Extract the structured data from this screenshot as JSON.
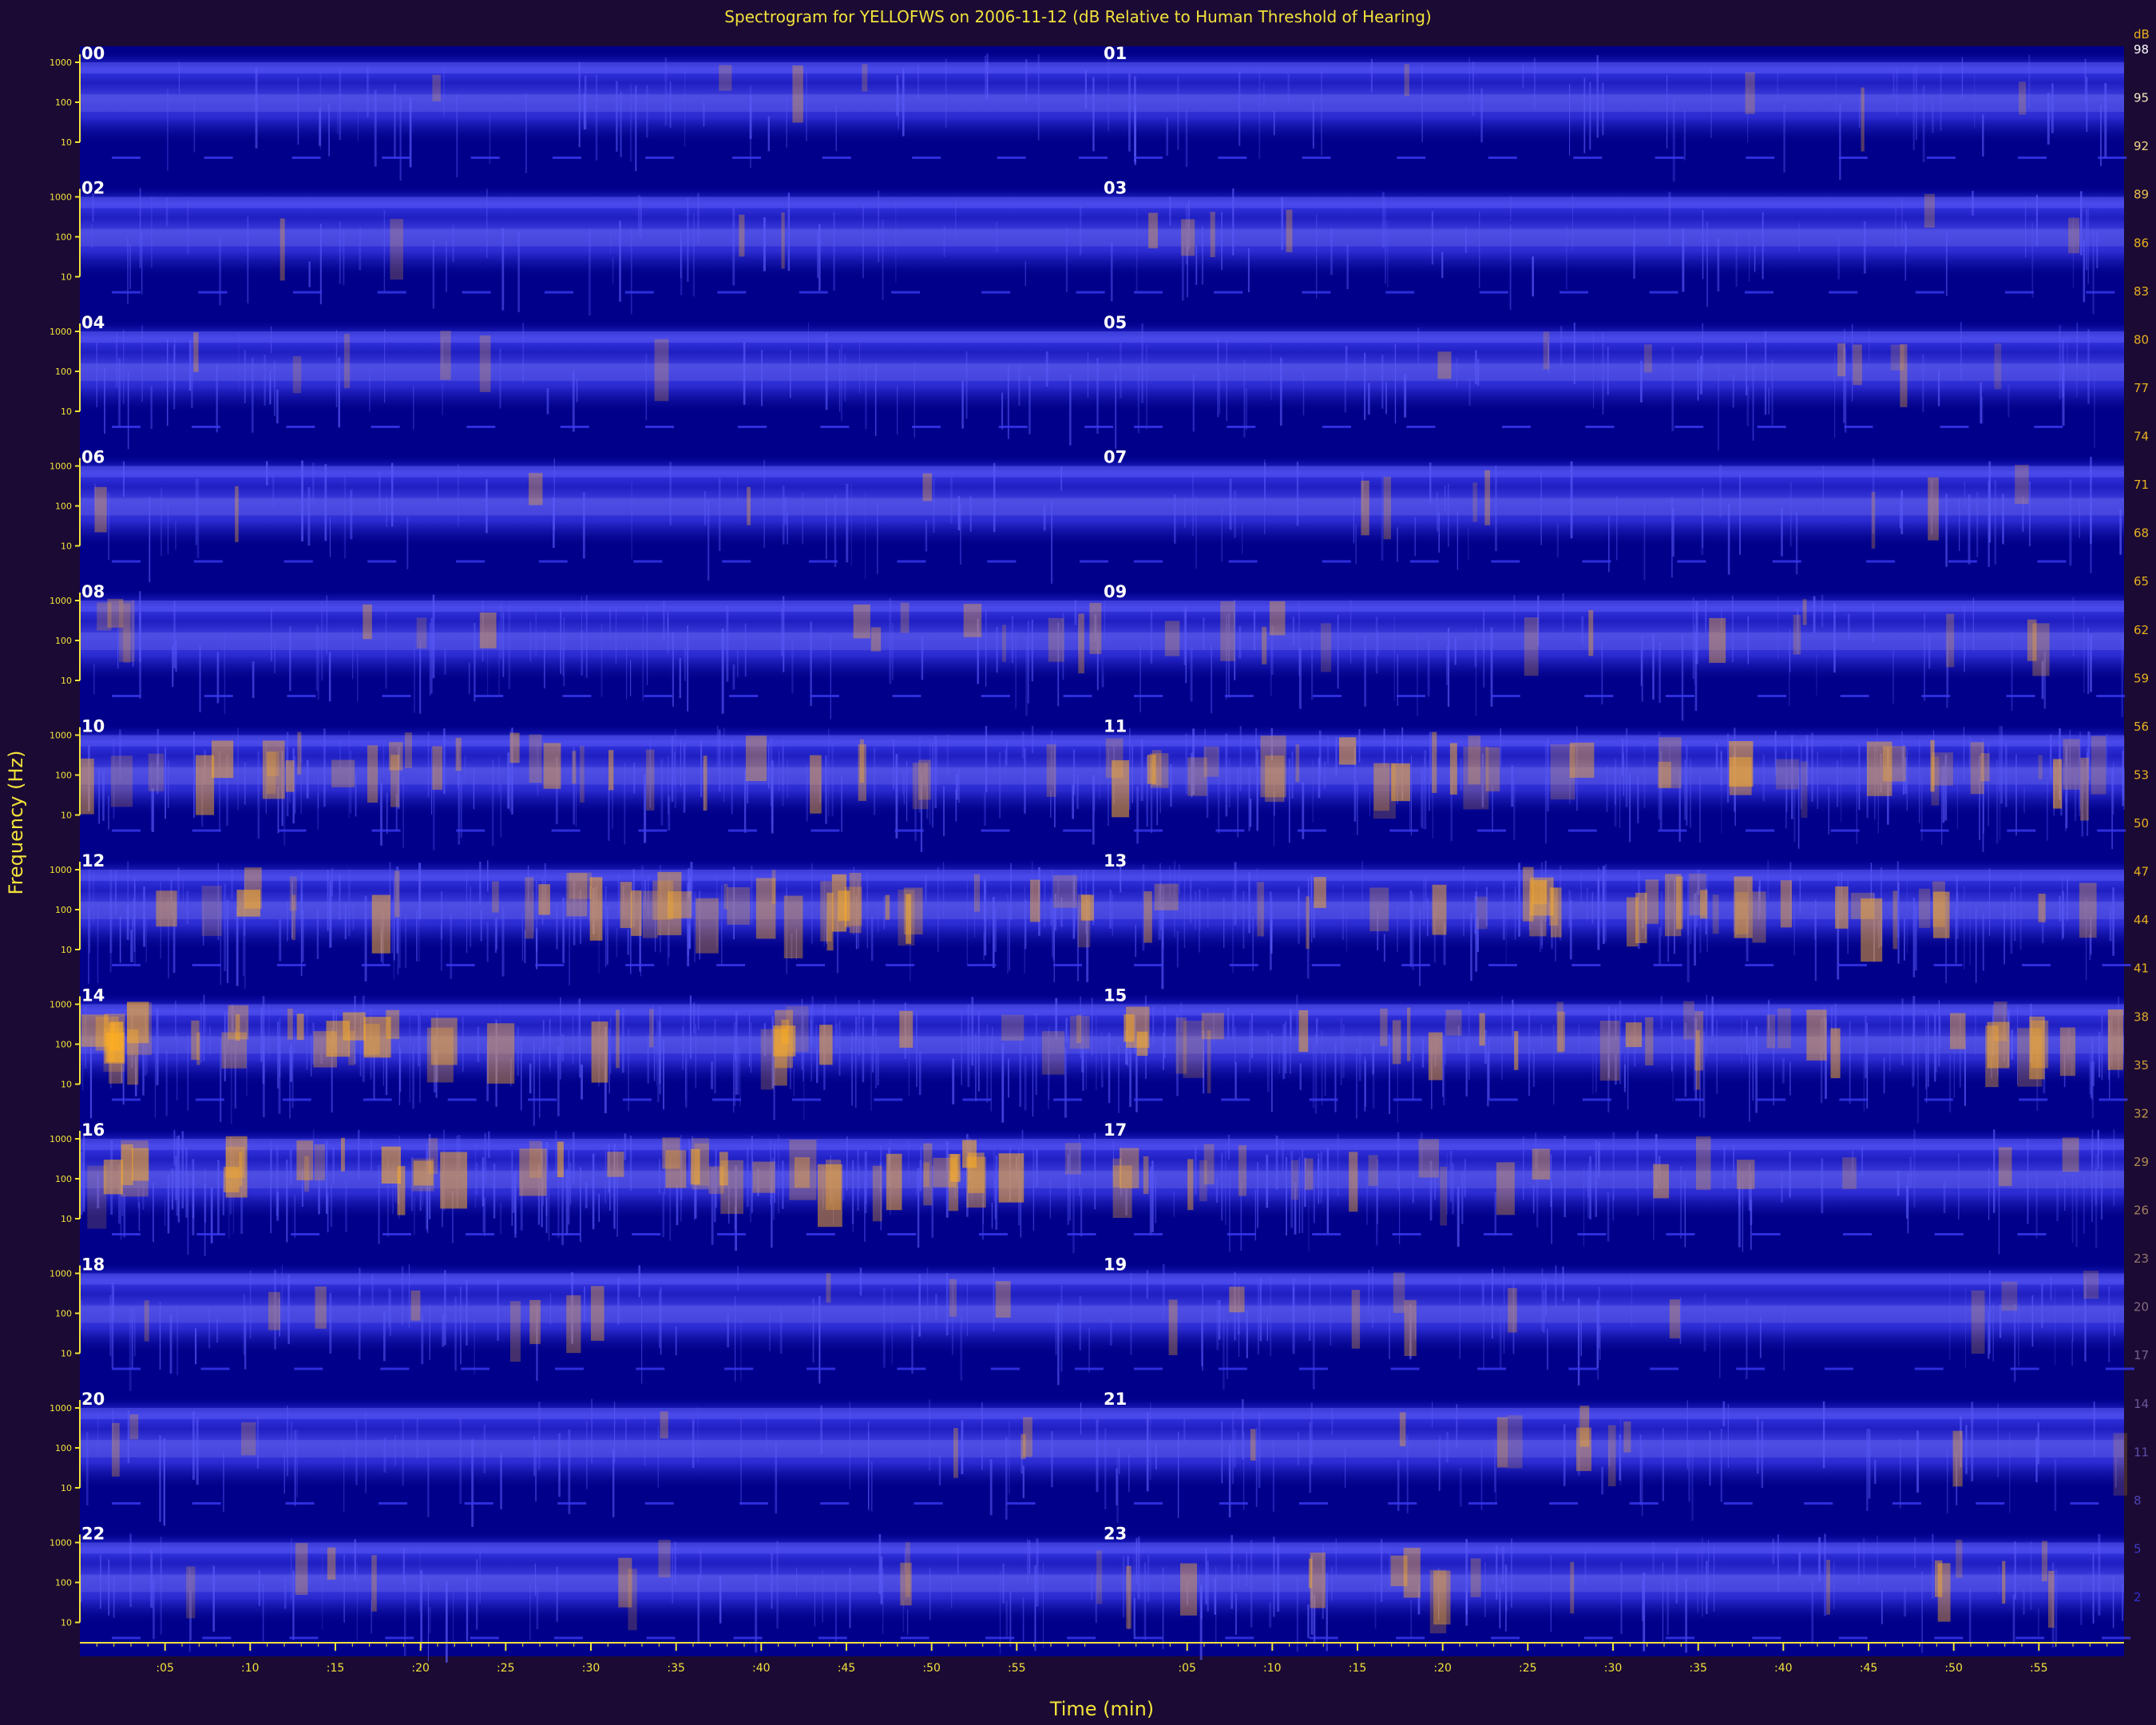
{
  "chart_data": {
    "type": "heatmap",
    "title": "Spectrogram for YELLOFWS on 2006-11-12 (dB Relative to Human Threshold of Hearing)",
    "xlabel": "Time (min)",
    "ylabel": "Frequency (Hz)",
    "x_ticks": [
      ":05",
      ":10",
      ":15",
      ":20",
      ":25",
      ":30",
      ":35",
      ":40",
      ":45",
      ":50",
      ":55"
    ],
    "freq_ticks": [
      "1000",
      "100",
      "10"
    ],
    "rows": [
      {
        "left_hour": "00",
        "right_hour": "01"
      },
      {
        "left_hour": "02",
        "right_hour": "03"
      },
      {
        "left_hour": "04",
        "right_hour": "05"
      },
      {
        "left_hour": "06",
        "right_hour": "07"
      },
      {
        "left_hour": "08",
        "right_hour": "09"
      },
      {
        "left_hour": "10",
        "right_hour": "11"
      },
      {
        "left_hour": "12",
        "right_hour": "13"
      },
      {
        "left_hour": "14",
        "right_hour": "15"
      },
      {
        "left_hour": "16",
        "right_hour": "17"
      },
      {
        "left_hour": "18",
        "right_hour": "19"
      },
      {
        "left_hour": "20",
        "right_hour": "21"
      },
      {
        "left_hour": "22",
        "right_hour": "23"
      }
    ],
    "activity": [
      [
        0.05,
        0.06
      ],
      [
        0.05,
        0.08
      ],
      [
        0.08,
        0.12
      ],
      [
        0.07,
        0.1
      ],
      [
        0.22,
        0.18
      ],
      [
        0.45,
        0.55
      ],
      [
        0.6,
        0.5
      ],
      [
        0.62,
        0.52
      ],
      [
        0.68,
        0.32
      ],
      [
        0.15,
        0.14
      ],
      [
        0.1,
        0.14
      ],
      [
        0.14,
        0.24
      ]
    ],
    "colorbar": {
      "unit": "dB",
      "ticks": [
        98,
        95,
        92,
        89,
        86,
        83,
        80,
        77,
        74,
        71,
        68,
        65,
        62,
        59,
        56,
        53,
        50,
        47,
        44,
        41,
        38,
        35,
        32,
        29,
        26,
        23,
        20,
        17,
        14,
        11,
        8,
        5,
        2
      ],
      "top_color": "#ffffff",
      "mid_color": "#e8b020",
      "low_color": "#3030d0"
    },
    "colors": {
      "background": "#1b0a33",
      "plot_background": "#00008a",
      "band_color": "#2a2ad8",
      "hot_color": "#ffb020",
      "axis_color": "#f2e23b"
    }
  }
}
